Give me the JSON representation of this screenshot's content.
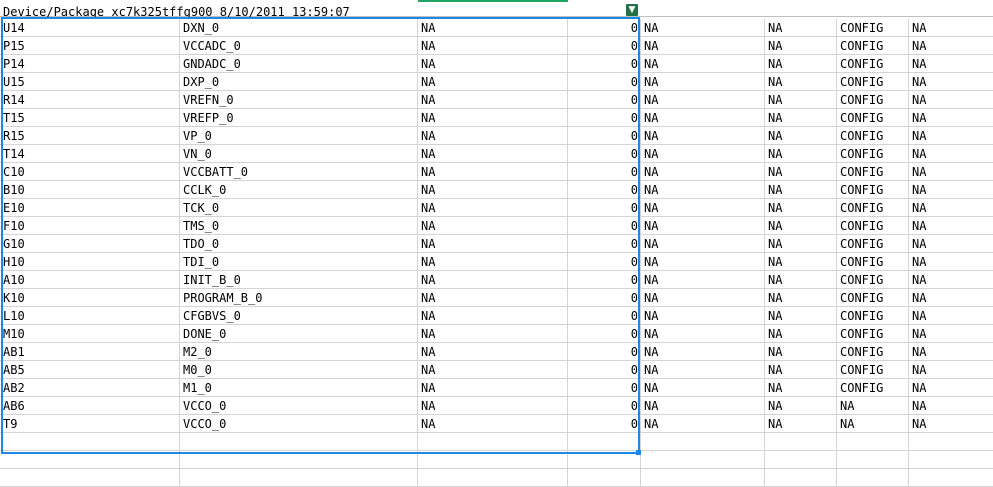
{
  "header": {
    "title": "Device/Package xc7k325tffg900 8/10/2011 13:59:07",
    "filter_icon": "filter-icon"
  },
  "rows": [
    [
      "U14",
      "DXN_0",
      "NA",
      "0",
      "NA",
      "NA",
      "CONFIG",
      "NA"
    ],
    [
      "P15",
      "VCCADC_0",
      "NA",
      "0",
      "NA",
      "NA",
      "CONFIG",
      "NA"
    ],
    [
      "P14",
      "GNDADC_0",
      "NA",
      "0",
      "NA",
      "NA",
      "CONFIG",
      "NA"
    ],
    [
      "U15",
      "DXP_0",
      "NA",
      "0",
      "NA",
      "NA",
      "CONFIG",
      "NA"
    ],
    [
      "R14",
      "VREFN_0",
      "NA",
      "0",
      "NA",
      "NA",
      "CONFIG",
      "NA"
    ],
    [
      "T15",
      "VREFP_0",
      "NA",
      "0",
      "NA",
      "NA",
      "CONFIG",
      "NA"
    ],
    [
      "R15",
      "VP_0",
      "NA",
      "0",
      "NA",
      "NA",
      "CONFIG",
      "NA"
    ],
    [
      "T14",
      "VN_0",
      "NA",
      "0",
      "NA",
      "NA",
      "CONFIG",
      "NA"
    ],
    [
      "C10",
      "VCCBATT_0",
      "NA",
      "0",
      "NA",
      "NA",
      "CONFIG",
      "NA"
    ],
    [
      "B10",
      "CCLK_0",
      "NA",
      "0",
      "NA",
      "NA",
      "CONFIG",
      "NA"
    ],
    [
      "E10",
      "TCK_0",
      "NA",
      "0",
      "NA",
      "NA",
      "CONFIG",
      "NA"
    ],
    [
      "F10",
      "TMS_0",
      "NA",
      "0",
      "NA",
      "NA",
      "CONFIG",
      "NA"
    ],
    [
      "G10",
      "TDO_0",
      "NA",
      "0",
      "NA",
      "NA",
      "CONFIG",
      "NA"
    ],
    [
      "H10",
      "TDI_0",
      "NA",
      "0",
      "NA",
      "NA",
      "CONFIG",
      "NA"
    ],
    [
      "A10",
      "INIT_B_0",
      "NA",
      "0",
      "NA",
      "NA",
      "CONFIG",
      "NA"
    ],
    [
      "K10",
      "PROGRAM_B_0",
      "NA",
      "0",
      "NA",
      "NA",
      "CONFIG",
      "NA"
    ],
    [
      "L10",
      "CFGBVS_0",
      "NA",
      "0",
      "NA",
      "NA",
      "CONFIG",
      "NA"
    ],
    [
      "M10",
      "DONE_0",
      "NA",
      "0",
      "NA",
      "NA",
      "CONFIG",
      "NA"
    ],
    [
      "AB1",
      "M2_0",
      "NA",
      "0",
      "NA",
      "NA",
      "CONFIG",
      "NA"
    ],
    [
      "AB5",
      "M0_0",
      "NA",
      "0",
      "NA",
      "NA",
      "CONFIG",
      "NA"
    ],
    [
      "AB2",
      "M1_0",
      "NA",
      "0",
      "NA",
      "NA",
      "CONFIG",
      "NA"
    ],
    [
      "AB6",
      "VCCO_0",
      "NA",
      "0",
      "NA",
      "NA",
      "NA",
      "NA"
    ],
    [
      "T9",
      "VCCO_0",
      "NA",
      "0",
      "NA",
      "NA",
      "NA",
      "NA"
    ]
  ],
  "colors": {
    "selection_border": "#1e88e5",
    "gridline": "#d4d4d4",
    "active_column_accent": "#21a366",
    "filter_icon_bg": "#217346"
  }
}
